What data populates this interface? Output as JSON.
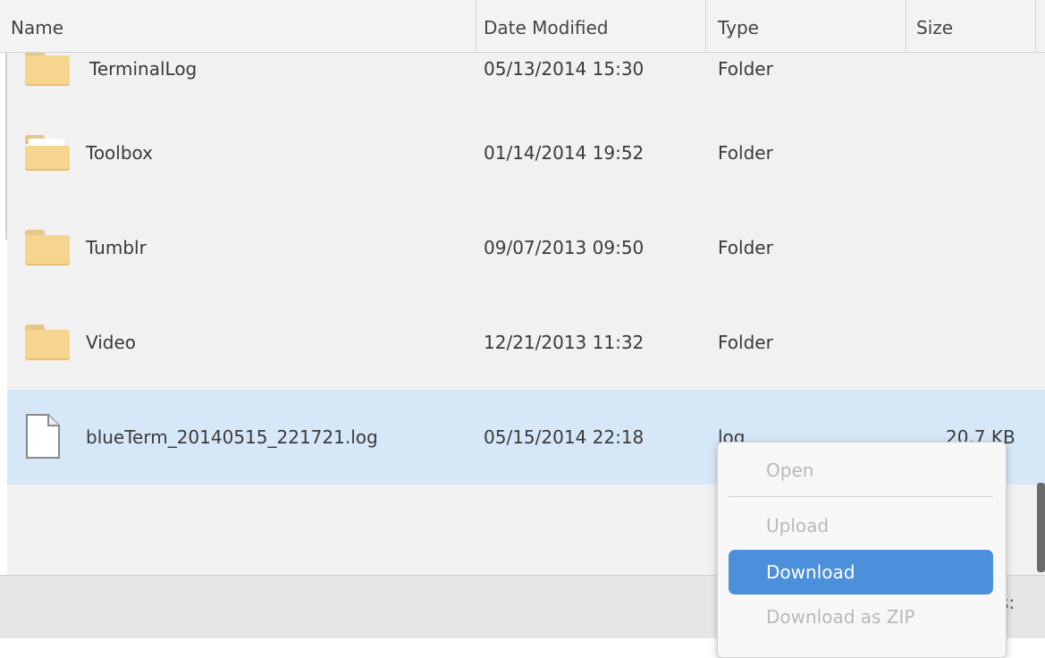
{
  "columns": {
    "name": "Name",
    "date": "Date Modified",
    "type": "Type",
    "size": "Size"
  },
  "rows": [
    {
      "name": "TerminalLog",
      "date": "05/13/2014 15:30",
      "type": "Folder",
      "size": "",
      "icon": "folder-icon"
    },
    {
      "name": "Toolbox",
      "date": "01/14/2014 19:52",
      "type": "Folder",
      "size": "",
      "icon": "folder-icon"
    },
    {
      "name": "Tumblr",
      "date": "09/07/2013 09:50",
      "type": "Folder",
      "size": "",
      "icon": "folder-icon"
    },
    {
      "name": "Video",
      "date": "12/21/2013 11:32",
      "type": "Folder",
      "size": "",
      "icon": "folder-icon"
    },
    {
      "name": "blueTerm_20140515_221721.log",
      "date": "05/15/2014 22:18",
      "type": "log",
      "size": "20.7 KB",
      "icon": "file-icon",
      "selected": true
    }
  ],
  "context_menu": {
    "open": "Open",
    "upload": "Upload",
    "download": "Download",
    "download_zip": "Download as ZIP"
  },
  "status": {
    "text": "s:"
  },
  "colors": {
    "selected_row": "#d6e7f8",
    "menu_highlight": "#4c8fdb",
    "folder": "#f6d58f"
  }
}
